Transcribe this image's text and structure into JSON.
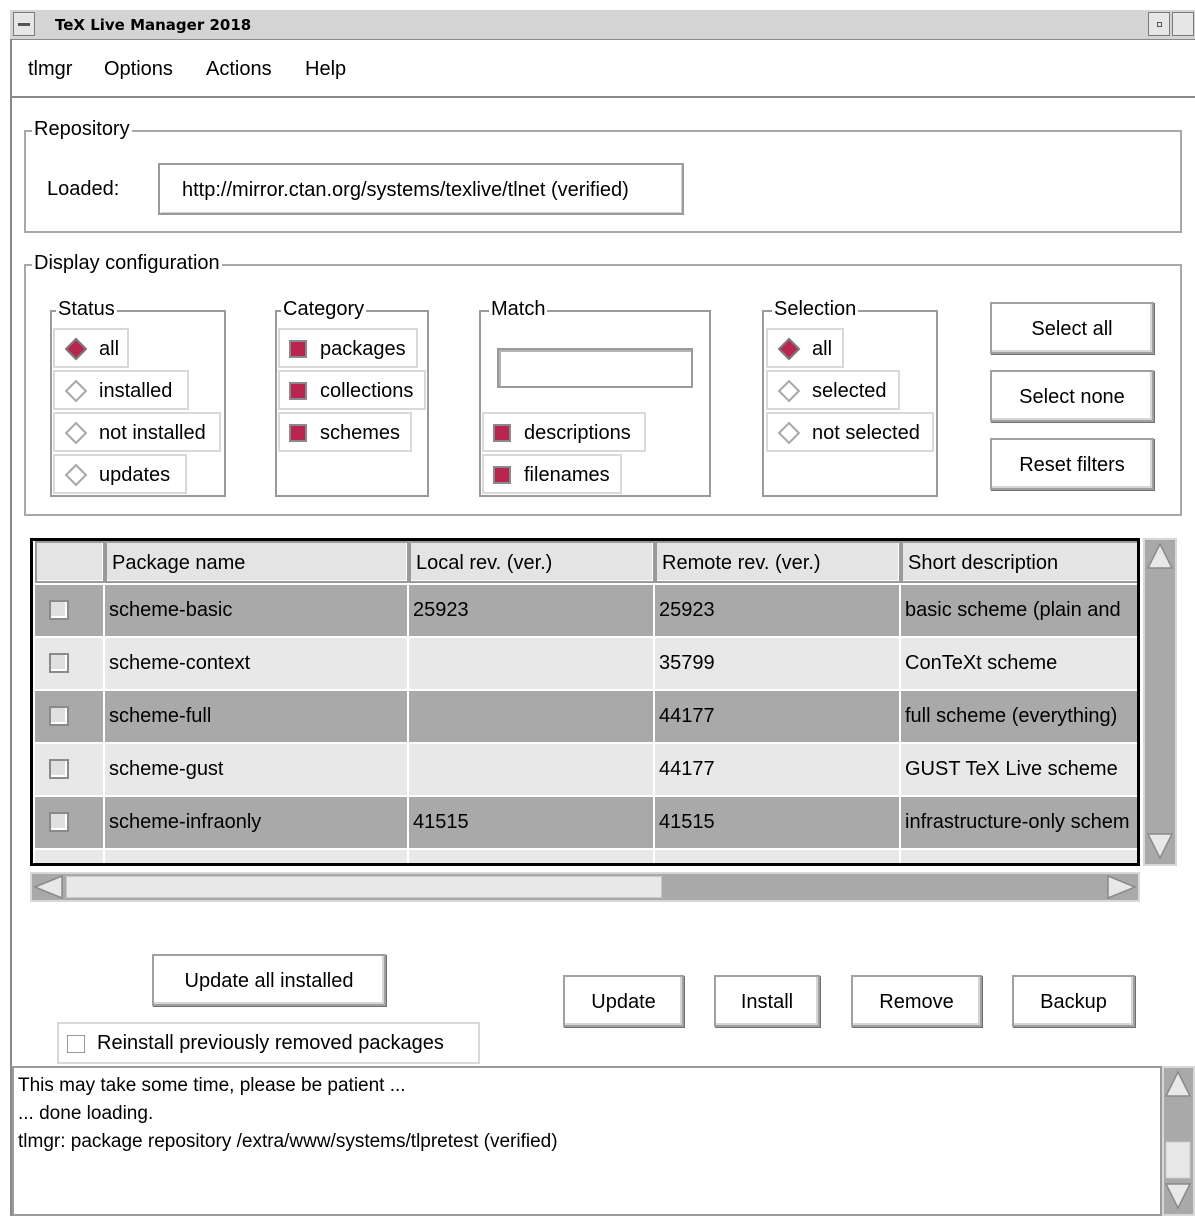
{
  "window": {
    "title": "TeX Live Manager 2018"
  },
  "menu": [
    "tlmgr",
    "Options",
    "Actions",
    "Help"
  ],
  "repository": {
    "legend": "Repository",
    "loaded_label": "Loaded:",
    "loaded_value": "http://mirror.ctan.org/systems/texlive/tlnet (verified)"
  },
  "display": {
    "legend": "Display configuration",
    "status": {
      "legend": "Status",
      "options": [
        "all",
        "installed",
        "not installed",
        "updates"
      ],
      "selected": "all"
    },
    "category": {
      "legend": "Category",
      "options": [
        "packages",
        "collections",
        "schemes"
      ]
    },
    "match": {
      "legend": "Match",
      "value": "",
      "options": [
        "descriptions",
        "filenames"
      ]
    },
    "selection": {
      "legend": "Selection",
      "options": [
        "all",
        "selected",
        "not selected"
      ],
      "selected": "all"
    },
    "buttons": {
      "select_all": "Select all",
      "select_none": "Select none",
      "reset_filters": "Reset filters"
    }
  },
  "table": {
    "headers": [
      "Package name",
      "Local rev. (ver.)",
      "Remote rev. (ver.)",
      "Short description"
    ],
    "rows": [
      {
        "name": "scheme-basic",
        "local": "25923",
        "remote": "25923",
        "desc": "basic scheme (plain and"
      },
      {
        "name": "scheme-context",
        "local": "",
        "remote": "35799",
        "desc": "ConTeXt scheme"
      },
      {
        "name": "scheme-full",
        "local": "",
        "remote": "44177",
        "desc": "full scheme (everything)"
      },
      {
        "name": "scheme-gust",
        "local": "",
        "remote": "44177",
        "desc": "GUST TeX Live scheme"
      },
      {
        "name": "scheme-infraonly",
        "local": "41515",
        "remote": "41515",
        "desc": "infrastructure-only schem"
      }
    ]
  },
  "actions": {
    "update_all": "Update all installed",
    "reinstall": "Reinstall previously removed packages",
    "update": "Update",
    "install": "Install",
    "remove": "Remove",
    "backup": "Backup"
  },
  "log": [
    "This may take some time, please be patient ...",
    "... done loading.",
    "tlmgr: package repository /extra/www/systems/tlpretest (verified)"
  ],
  "colors": {
    "accent": "#b8264f",
    "row_dark": "#a9a9a9",
    "row_light": "#e8e8e8"
  }
}
